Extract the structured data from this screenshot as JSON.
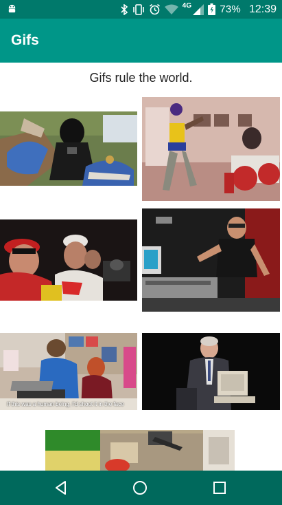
{
  "status_bar": {
    "battery": "73%",
    "time": "12:39",
    "network": "4G",
    "icons": [
      "android-icon",
      "bluetooth-icon",
      "vibrate-icon",
      "alarm-icon",
      "wifi-icon",
      "signal-icon",
      "battery-icon"
    ]
  },
  "app_bar": {
    "title": "Gifs"
  },
  "main": {
    "headline": "Gifs rule the world.",
    "gifs": [
      {
        "subject": "darth-vader-ride"
      },
      {
        "subject": "dancing-kid"
      },
      {
        "subject": "race-crowd"
      },
      {
        "subject": "studio-dance"
      },
      {
        "subject": "office-laptop",
        "caption": "If this was a human being, I'd shoot it in the face"
      },
      {
        "subject": "man-at-computer"
      },
      {
        "subject": "cartoon-scene"
      }
    ]
  },
  "nav_bar": {
    "buttons": [
      "back-icon",
      "home-icon",
      "recents-icon"
    ]
  },
  "colors": {
    "status": "#00796b",
    "appbar": "#009688",
    "nav": "#00695c"
  }
}
